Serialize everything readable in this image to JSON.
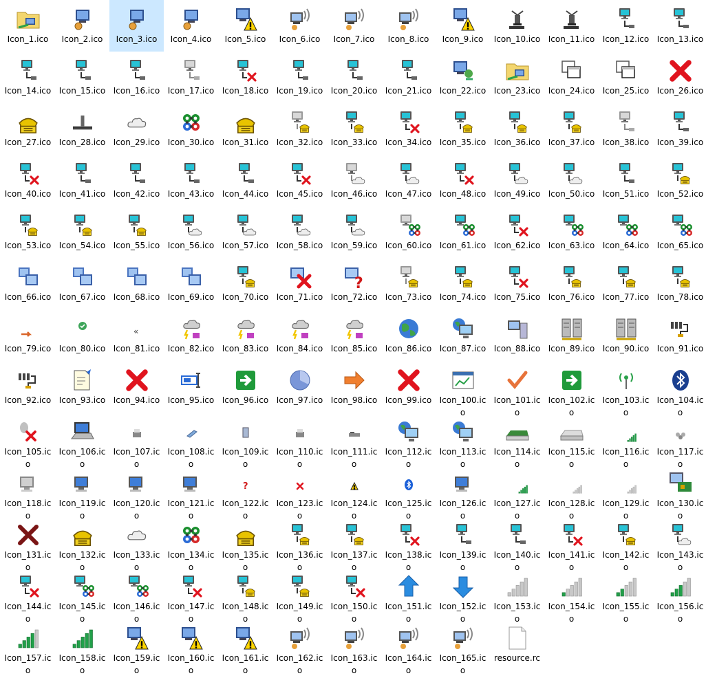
{
  "window": {
    "view": "large-icons"
  },
  "selected_index": 2,
  "files": [
    {
      "name": "Icon_1.ico",
      "icon": "folder-network-icon"
    },
    {
      "name": "Icon_2.ico",
      "icon": "network-computer-icon"
    },
    {
      "name": "Icon_3.ico",
      "icon": "network-computer-icon"
    },
    {
      "name": "Icon_4.ico",
      "icon": "network-computer-icon"
    },
    {
      "name": "Icon_5.ico",
      "icon": "network-warning-icon"
    },
    {
      "name": "Icon_6.ico",
      "icon": "network-wireless-icon"
    },
    {
      "name": "Icon_7.ico",
      "icon": "network-wireless-icon"
    },
    {
      "name": "Icon_8.ico",
      "icon": "network-wireless-icon"
    },
    {
      "name": "Icon_9.ico",
      "icon": "network-warning-icon"
    },
    {
      "name": "Icon_10.ico",
      "icon": "plug-icon"
    },
    {
      "name": "Icon_11.ico",
      "icon": "plug-icon"
    },
    {
      "name": "Icon_12.ico",
      "icon": "lan-computer-icon"
    },
    {
      "name": "Icon_13.ico",
      "icon": "lan-computer-icon"
    },
    {
      "name": "Icon_14.ico",
      "icon": "lan-computer-icon"
    },
    {
      "name": "Icon_15.ico",
      "icon": "lan-computer-icon"
    },
    {
      "name": "Icon_16.ico",
      "icon": "lan-computer-icon"
    },
    {
      "name": "Icon_17.ico",
      "icon": "lan-computer-grey-icon"
    },
    {
      "name": "Icon_18.ico",
      "icon": "lan-disconnected-icon"
    },
    {
      "name": "Icon_19.ico",
      "icon": "lan-computer-icon"
    },
    {
      "name": "Icon_20.ico",
      "icon": "lan-computer-icon"
    },
    {
      "name": "Icon_21.ico",
      "icon": "lan-computer-icon"
    },
    {
      "name": "Icon_22.ico",
      "icon": "network-setup-icon"
    },
    {
      "name": "Icon_23.ico",
      "icon": "folder-network-icon"
    },
    {
      "name": "Icon_24.ico",
      "icon": "window-copy-icon"
    },
    {
      "name": "Icon_25.ico",
      "icon": "window-copy-icon"
    },
    {
      "name": "Icon_26.ico",
      "icon": "red-x-icon"
    },
    {
      "name": "Icon_27.ico",
      "icon": "phone-icon"
    },
    {
      "name": "Icon_28.ico",
      "icon": "network-tee-icon"
    },
    {
      "name": "Icon_29.ico",
      "icon": "cloud-icon"
    },
    {
      "name": "Icon_30.ico",
      "icon": "command-icon"
    },
    {
      "name": "Icon_31.ico",
      "icon": "phone-icon"
    },
    {
      "name": "Icon_32.ico",
      "icon": "lan-phone-grey-icon"
    },
    {
      "name": "Icon_33.ico",
      "icon": "lan-phone-icon"
    },
    {
      "name": "Icon_34.ico",
      "icon": "lan-disconnected-icon"
    },
    {
      "name": "Icon_35.ico",
      "icon": "lan-phone-icon"
    },
    {
      "name": "Icon_36.ico",
      "icon": "lan-phone-icon"
    },
    {
      "name": "Icon_37.ico",
      "icon": "lan-phone-icon"
    },
    {
      "name": "Icon_38.ico",
      "icon": "lan-computer-grey-icon"
    },
    {
      "name": "Icon_39.ico",
      "icon": "lan-computer-icon"
    },
    {
      "name": "Icon_40.ico",
      "icon": "lan-disconnected-icon"
    },
    {
      "name": "Icon_41.ico",
      "icon": "lan-computer-icon"
    },
    {
      "name": "Icon_42.ico",
      "icon": "lan-computer-icon"
    },
    {
      "name": "Icon_43.ico",
      "icon": "lan-computer-icon"
    },
    {
      "name": "Icon_44.ico",
      "icon": "lan-computer-icon"
    },
    {
      "name": "Icon_45.ico",
      "icon": "lan-disconnected-icon"
    },
    {
      "name": "Icon_46.ico",
      "icon": "lan-cloud-grey-icon"
    },
    {
      "name": "Icon_47.ico",
      "icon": "lan-cloud-icon"
    },
    {
      "name": "Icon_48.ico",
      "icon": "lan-disconnected-icon"
    },
    {
      "name": "Icon_49.ico",
      "icon": "lan-cloud-icon"
    },
    {
      "name": "Icon_50.ico",
      "icon": "lan-cloud-icon"
    },
    {
      "name": "Icon_51.ico",
      "icon": "lan-computer-icon"
    },
    {
      "name": "Icon_52.ico",
      "icon": "lan-phone-icon"
    },
    {
      "name": "Icon_53.ico",
      "icon": "lan-phone-icon"
    },
    {
      "name": "Icon_54.ico",
      "icon": "lan-phone-icon"
    },
    {
      "name": "Icon_55.ico",
      "icon": "lan-phone-icon"
    },
    {
      "name": "Icon_56.ico",
      "icon": "lan-cloud-icon"
    },
    {
      "name": "Icon_57.ico",
      "icon": "lan-cloud-icon"
    },
    {
      "name": "Icon_58.ico",
      "icon": "lan-cloud-icon"
    },
    {
      "name": "Icon_59.ico",
      "icon": "lan-cloud-icon"
    },
    {
      "name": "Icon_60.ico",
      "icon": "lan-command-grey-icon"
    },
    {
      "name": "Icon_61.ico",
      "icon": "lan-command-icon"
    },
    {
      "name": "Icon_62.ico",
      "icon": "lan-disconnected-icon"
    },
    {
      "name": "Icon_63.ico",
      "icon": "lan-command-icon"
    },
    {
      "name": "Icon_64.ico",
      "icon": "lan-command-icon"
    },
    {
      "name": "Icon_65.ico",
      "icon": "lan-command-icon"
    },
    {
      "name": "Icon_66.ico",
      "icon": "network-computers-icon"
    },
    {
      "name": "Icon_67.ico",
      "icon": "network-computers-icon"
    },
    {
      "name": "Icon_68.ico",
      "icon": "network-computers-icon"
    },
    {
      "name": "Icon_69.ico",
      "icon": "network-computers-icon"
    },
    {
      "name": "Icon_70.ico",
      "icon": "lan-phone-icon"
    },
    {
      "name": "Icon_71.ico",
      "icon": "network-error-icon"
    },
    {
      "name": "Icon_72.ico",
      "icon": "network-unknown-icon"
    },
    {
      "name": "Icon_73.ico",
      "icon": "lan-phone-grey-icon"
    },
    {
      "name": "Icon_74.ico",
      "icon": "lan-phone-icon"
    },
    {
      "name": "Icon_75.ico",
      "icon": "lan-disconnected-icon"
    },
    {
      "name": "Icon_76.ico",
      "icon": "lan-phone-icon"
    },
    {
      "name": "Icon_77.ico",
      "icon": "lan-phone-icon"
    },
    {
      "name": "Icon_78.ico",
      "icon": "lan-phone-icon"
    },
    {
      "name": "Icon_79.ico",
      "icon": "small-arrow-icon"
    },
    {
      "name": "Icon_80.ico",
      "icon": "small-check-icon"
    },
    {
      "name": "Icon_81.ico",
      "icon": "small-chevron-icon"
    },
    {
      "name": "Icon_82.ico",
      "icon": "storm-cloud-icon"
    },
    {
      "name": "Icon_83.ico",
      "icon": "storm-cloud-icon"
    },
    {
      "name": "Icon_84.ico",
      "icon": "storm-cloud-icon"
    },
    {
      "name": "Icon_85.ico",
      "icon": "storm-cloud-icon"
    },
    {
      "name": "Icon_86.ico",
      "icon": "globe-icon"
    },
    {
      "name": "Icon_87.ico",
      "icon": "globe-computer-icon"
    },
    {
      "name": "Icon_88.ico",
      "icon": "computer-tower-icon"
    },
    {
      "name": "Icon_89.ico",
      "icon": "server-icon"
    },
    {
      "name": "Icon_90.ico",
      "icon": "server-icon"
    },
    {
      "name": "Icon_91.ico",
      "icon": "network-adapter-icon"
    },
    {
      "name": "Icon_92.ico",
      "icon": "network-adapter-icon"
    },
    {
      "name": "Icon_93.ico",
      "icon": "document-arrow-icon"
    },
    {
      "name": "Icon_94.ico",
      "icon": "red-x-icon"
    },
    {
      "name": "Icon_95.ico",
      "icon": "rename-icon"
    },
    {
      "name": "Icon_96.ico",
      "icon": "green-arrow-icon"
    },
    {
      "name": "Icon_97.ico",
      "icon": "chart-pie-icon"
    },
    {
      "name": "Icon_98.ico",
      "icon": "orange-arrow-icon"
    },
    {
      "name": "Icon_99.ico",
      "icon": "red-x-icon"
    },
    {
      "name": "Icon_100.ico",
      "icon": "window-chart-icon"
    },
    {
      "name": "Icon_101.ico",
      "icon": "orange-check-icon"
    },
    {
      "name": "Icon_102.ico",
      "icon": "green-arrow-icon"
    },
    {
      "name": "Icon_103.ico",
      "icon": "wireless-antenna-icon"
    },
    {
      "name": "Icon_104.ico",
      "icon": "bluetooth-icon"
    },
    {
      "name": "Icon_105.ico",
      "icon": "bluetooth-disabled-icon"
    },
    {
      "name": "Icon_106.ico",
      "icon": "laptop-icon"
    },
    {
      "name": "Icon_107.ico",
      "icon": "small-printer-icon"
    },
    {
      "name": "Icon_108.ico",
      "icon": "small-device-icon"
    },
    {
      "name": "Icon_109.ico",
      "icon": "small-tower-icon"
    },
    {
      "name": "Icon_110.ico",
      "icon": "small-printer-icon"
    },
    {
      "name": "Icon_111.ico",
      "icon": "small-router-icon"
    },
    {
      "name": "Icon_112.ico",
      "icon": "globe-computer-icon"
    },
    {
      "name": "Icon_113.ico",
      "icon": "globe-computer-icon"
    },
    {
      "name": "Icon_114.ico",
      "icon": "router-icon"
    },
    {
      "name": "Icon_115.ico",
      "icon": "router-grey-icon"
    },
    {
      "name": "Icon_116.ico",
      "icon": "small-signal-icon"
    },
    {
      "name": "Icon_117.ico",
      "icon": "small-hub-icon"
    },
    {
      "name": "Icon_118.ico",
      "icon": "computer-grey-icon"
    },
    {
      "name": "Icon_119.ico",
      "icon": "computer-icon"
    },
    {
      "name": "Icon_120.ico",
      "icon": "computer-icon"
    },
    {
      "name": "Icon_121.ico",
      "icon": "computer-icon"
    },
    {
      "name": "Icon_122.ico",
      "icon": "small-question-icon"
    },
    {
      "name": "Icon_123.ico",
      "icon": "small-x-icon"
    },
    {
      "name": "Icon_124.ico",
      "icon": "small-warning-icon"
    },
    {
      "name": "Icon_125.ico",
      "icon": "small-bluetooth-icon"
    },
    {
      "name": "Icon_126.ico",
      "icon": "computer-icon"
    },
    {
      "name": "Icon_127.ico",
      "icon": "small-signal-icon"
    },
    {
      "name": "Icon_128.ico",
      "icon": "small-signal-grey-icon"
    },
    {
      "name": "Icon_129.ico",
      "icon": "small-signal-grey-icon"
    },
    {
      "name": "Icon_130.ico",
      "icon": "computer-card-icon"
    },
    {
      "name": "Icon_131.ico",
      "icon": "dark-x-icon"
    },
    {
      "name": "Icon_132.ico",
      "icon": "phone-icon"
    },
    {
      "name": "Icon_133.ico",
      "icon": "cloud-icon"
    },
    {
      "name": "Icon_134.ico",
      "icon": "command-icon"
    },
    {
      "name": "Icon_135.ico",
      "icon": "phone-icon"
    },
    {
      "name": "Icon_136.ico",
      "icon": "lan-phone-icon"
    },
    {
      "name": "Icon_137.ico",
      "icon": "lan-phone-icon"
    },
    {
      "name": "Icon_138.ico",
      "icon": "lan-disconnected-icon"
    },
    {
      "name": "Icon_139.ico",
      "icon": "lan-computer-icon"
    },
    {
      "name": "Icon_140.ico",
      "icon": "lan-computer-icon"
    },
    {
      "name": "Icon_141.ico",
      "icon": "lan-disconnected-icon"
    },
    {
      "name": "Icon_142.ico",
      "icon": "lan-phone-icon"
    },
    {
      "name": "Icon_143.ico",
      "icon": "lan-cloud-icon"
    },
    {
      "name": "Icon_144.ico",
      "icon": "lan-disconnected-icon"
    },
    {
      "name": "Icon_145.ico",
      "icon": "lan-command-icon"
    },
    {
      "name": "Icon_146.ico",
      "icon": "lan-command-icon"
    },
    {
      "name": "Icon_147.ico",
      "icon": "lan-disconnected-icon"
    },
    {
      "name": "Icon_148.ico",
      "icon": "lan-phone-icon"
    },
    {
      "name": "Icon_149.ico",
      "icon": "lan-phone-icon"
    },
    {
      "name": "Icon_150.ico",
      "icon": "lan-disconnected-icon"
    },
    {
      "name": "Icon_151.ico",
      "icon": "blue-up-arrow-icon"
    },
    {
      "name": "Icon_152.ico",
      "icon": "blue-down-arrow-icon"
    },
    {
      "name": "Icon_153.ico",
      "icon": "signal-bars-icon",
      "level": 0
    },
    {
      "name": "Icon_154.ico",
      "icon": "signal-bars-icon",
      "level": 1
    },
    {
      "name": "Icon_155.ico",
      "icon": "signal-bars-icon",
      "level": 2
    },
    {
      "name": "Icon_156.ico",
      "icon": "signal-bars-icon",
      "level": 3
    },
    {
      "name": "Icon_157.ico",
      "icon": "signal-bars-icon",
      "level": 4
    },
    {
      "name": "Icon_158.ico",
      "icon": "signal-bars-icon",
      "level": 5
    },
    {
      "name": "Icon_159.ico",
      "icon": "network-warning-icon"
    },
    {
      "name": "Icon_160.ico",
      "icon": "network-warning-icon"
    },
    {
      "name": "Icon_161.ico",
      "icon": "network-warning-icon"
    },
    {
      "name": "Icon_162.ico",
      "icon": "network-wireless-icon"
    },
    {
      "name": "Icon_163.ico",
      "icon": "network-wireless-icon"
    },
    {
      "name": "Icon_164.ico",
      "icon": "network-wireless-icon"
    },
    {
      "name": "Icon_165.ico",
      "icon": "network-wireless-icon"
    },
    {
      "name": "resource.rc",
      "icon": "text-file-icon"
    }
  ]
}
